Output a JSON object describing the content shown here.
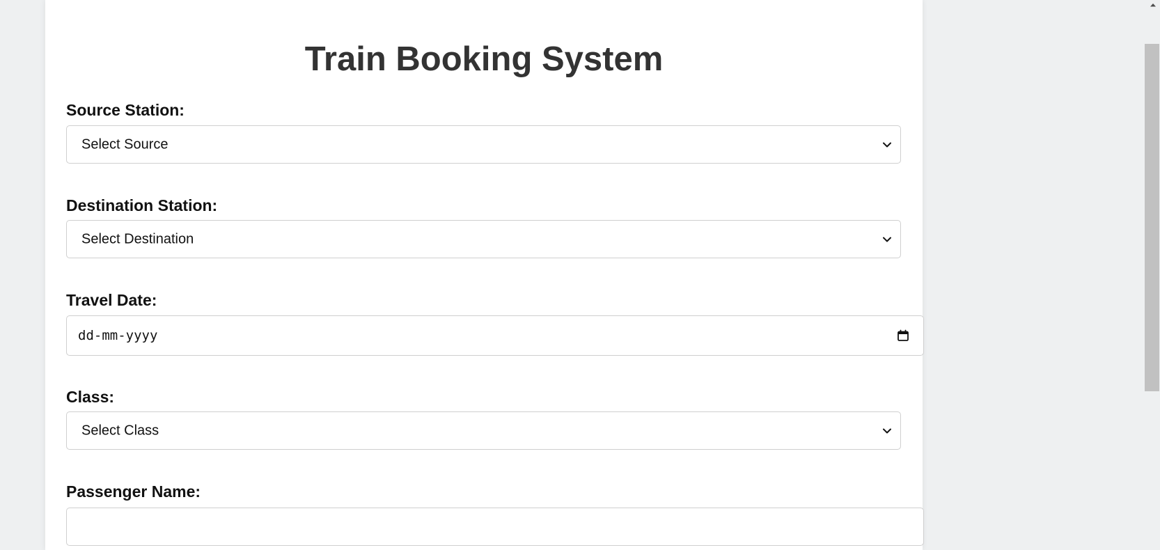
{
  "page": {
    "title": "Train Booking System"
  },
  "form": {
    "source": {
      "label": "Source Station:",
      "selected": "Select Source"
    },
    "destination": {
      "label": "Destination Station:",
      "selected": "Select Destination"
    },
    "travel_date": {
      "label": "Travel Date:",
      "placeholder": "dd-mm-yyyy"
    },
    "class": {
      "label": "Class:",
      "selected": "Select Class"
    },
    "passenger_name": {
      "label": "Passenger Name:",
      "value": ""
    }
  },
  "icons": {
    "dropdown": "chevron-down-icon",
    "date": "calendar-icon",
    "scroll_up": "arrow-up-icon"
  },
  "colors": {
    "page_background": "#eef0f1",
    "card_background": "#ffffff",
    "title_text": "#333333",
    "input_border": "#cfcfcf",
    "scrollbar_thumb": "#c1c1c1"
  }
}
